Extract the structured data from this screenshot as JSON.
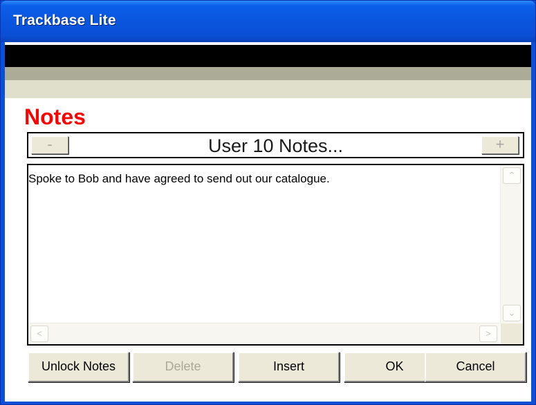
{
  "window": {
    "title": "Trackbase Lite",
    "title_bar_color": "#0a55de"
  },
  "notes": {
    "heading": "Notes",
    "heading_color": "#ff0000",
    "nav": {
      "prev_label": "-",
      "title": "User 10 Notes...",
      "next_label": "+"
    },
    "text": "Spoke to Bob and have agreed to send out our catalogue."
  },
  "scrollbars": {
    "up_icon": "chevron-up-icon",
    "down_icon": "chevron-down-icon",
    "left_icon": "chevron-left-icon",
    "right_icon": "chevron-right-icon",
    "up_glyph": "⌃",
    "down_glyph": "⌄",
    "left_glyph": "<",
    "right_glyph": ">"
  },
  "buttons": {
    "unlock_notes": "Unlock Notes",
    "delete": "Delete",
    "insert": "Insert",
    "ok": "OK",
    "cancel": "Cancel"
  }
}
